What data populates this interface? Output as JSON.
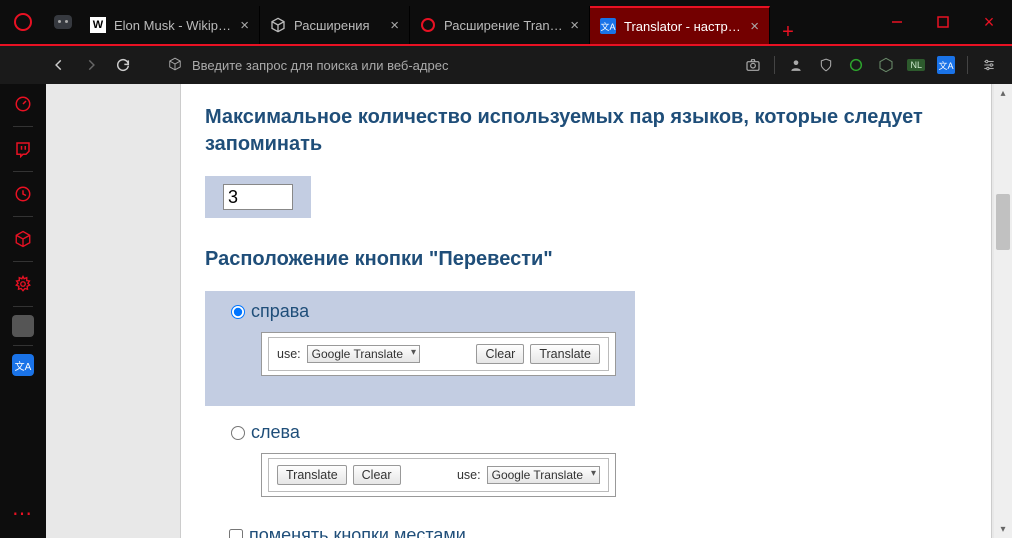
{
  "tabs": [
    {
      "label": "Elon Musk - Wikipedia"
    },
    {
      "label": "Расширения"
    },
    {
      "label": "Расширение Translator"
    },
    {
      "label": "Translator - настройки"
    }
  ],
  "addressbar": {
    "placeholder": "Введите запрос для поиска или веб-адрес"
  },
  "nav_badge": "NL",
  "page": {
    "heading_maxpairs": "Максимальное количество используемых пар языков, которые следует запоминать",
    "maxpairs_value": "3",
    "heading_position": "Расположение кнопки \"Перевести\"",
    "opt_right": "справа",
    "opt_left": "слева",
    "preview": {
      "use_label": "use:",
      "select_label": "Google Translate",
      "clear_label": "Clear",
      "translate_label": "Translate"
    },
    "swap_label": "поменять кнопки местами"
  }
}
